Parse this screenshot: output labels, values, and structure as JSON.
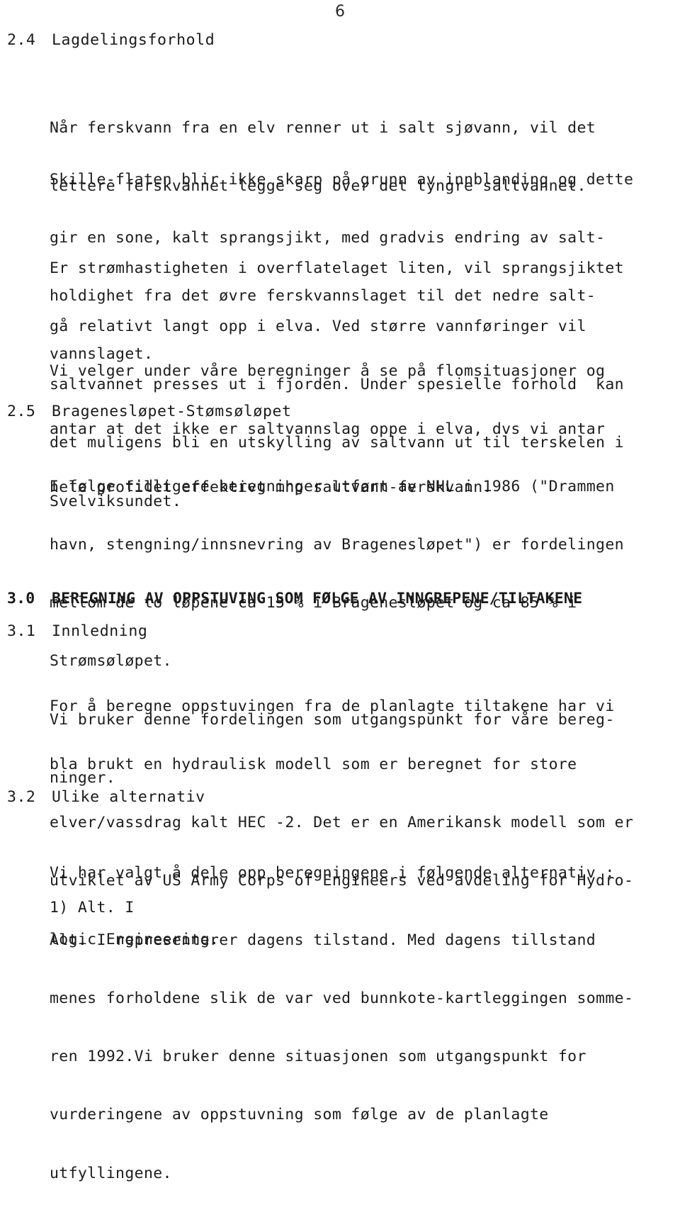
{
  "document": {
    "page_number": "6",
    "language": "Norwegian",
    "colors": {
      "background": "#ffffff",
      "text": "#1c1c1c",
      "page_number_text": "#2a2a2a"
    }
  },
  "sections": [
    {
      "number": "2.4",
      "title": "Lagdelingsforhold",
      "bold": false
    },
    {
      "number": "2.5",
      "title": "Bragenesløpet-Stømsøløpet",
      "bold": false
    },
    {
      "number": "3.0",
      "title": "BEREGNING AV OPPSTUVING SOM FØLGE AV INNGREPENE/TILTAKENE",
      "bold": true
    },
    {
      "number": "3.1",
      "title": "Innledning",
      "bold": false
    },
    {
      "number": "3.2",
      "title": "Ulike alternativ",
      "bold": false
    }
  ],
  "paragraphs": {
    "p1": {
      "lines": [
        "Når ferskvann fra en elv renner ut i salt sjøvann, vil det",
        "lettere ferskvannet legge seg over det tyngre saltvannet."
      ]
    },
    "p2": {
      "lines": [
        "Skille-flaten blir ikke skarp på grunn av innblanding og dette",
        "gir en sone, kalt sprangsjikt, med gradvis endring av salt-",
        "holdighet fra det øvre ferskvannslaget til det nedre salt-",
        "vannslaget."
      ]
    },
    "p3": {
      "lines": [
        "Er strømhastigheten i overflatelaget liten, vil sprangsjiktet",
        "gå relativt langt opp i elva. Ved større vannføringer vil",
        "saltvannet presses ut i fjorden. Under spesielle forhold  kan",
        "det muligens bli en utskylling av saltvann ut til terskelen i",
        "Svelviksundet."
      ]
    },
    "p4": {
      "lines": [
        "Vi velger under våre beregninger å se på flomsituasjoner og",
        "antar at det ikke er saltvannslag oppe i elva, dvs vi antar",
        "hele profilet effektivt mhp saltvann-ferskvann."
      ]
    },
    "p5": {
      "lines": [
        "I følge tidligere beregninger utført av NHL i 1986 (\"Drammen",
        "havn, stengning/innsnevring av Bragenesløpet\") er fordelingen",
        "mellom de to løpene ca 15 % i Bragenesløpet og ca 85 % i",
        "Strømsøløpet.",
        "Vi bruker denne fordelingen som utgangspunkt for våre bereg-",
        "ninger."
      ]
    },
    "p6": {
      "lines": [
        "For å beregne oppstuvingen fra de planlagte tiltakene har vi",
        "bla brukt en hydraulisk modell som er beregnet for store",
        "elver/vassdrag kalt HEC -2. Det er en Amerikansk modell som er",
        "utviklet av US Army Corps of Engineers ved avdeling for Hydro-",
        "logic Engineering."
      ]
    },
    "p7": {
      "lines": [
        "Vi har valgt å dele opp beregningene i følgende alternativ :"
      ]
    },
    "p8": {
      "lines": [
        "1) Alt. I"
      ]
    },
    "p9": {
      "lines": [
        "Alt. I representerer dagens tilstand. Med dagens tillstand",
        "menes forholdene slik de var ved bunnkote-kartleggingen somme-",
        "ren 1992.Vi bruker denne situasjonen som utgangspunkt for",
        "vurderingene av oppstuvning som følge av de planlagte",
        "utfyllingene."
      ]
    }
  }
}
